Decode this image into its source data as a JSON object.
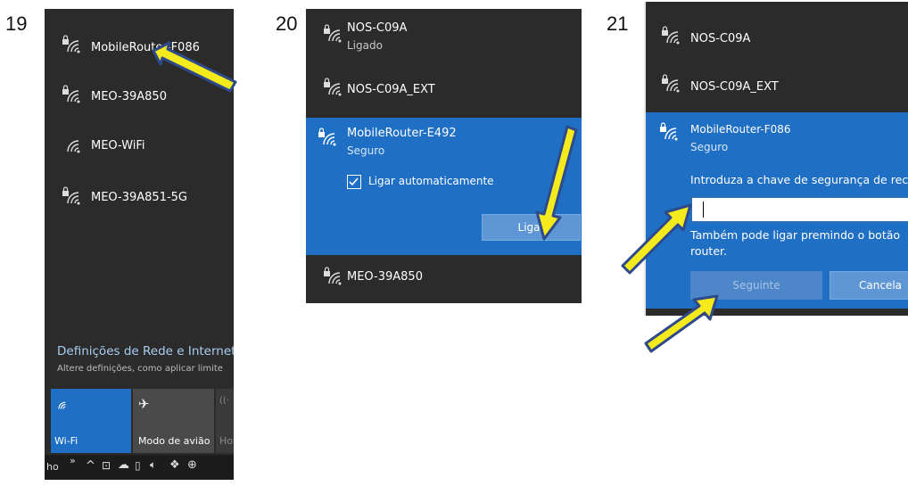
{
  "steps": [
    "19",
    "20",
    "21"
  ],
  "panel19": {
    "networks": [
      {
        "name": "MobileRouter-F086",
        "secured": true
      },
      {
        "name": "MEO-39A850",
        "secured": true
      },
      {
        "name": "MEO-WiFi",
        "secured": false
      },
      {
        "name": "MEO-39A851-5G",
        "secured": true
      }
    ],
    "settings_title": "Definições de Rede e Internet",
    "settings_sub": "Altere definições, como aplicar limite",
    "tiles": {
      "wifi": "Wi-Fi",
      "airplane": "Modo de avião",
      "hotspot": "Hot"
    },
    "taskbar_left": "ho",
    "taskbar_chevron": "»"
  },
  "panel20": {
    "networks_top": [
      {
        "name": "NOS-C09A",
        "status": "Ligado"
      },
      {
        "name": "NOS-C09A_EXT"
      }
    ],
    "selected": {
      "name": "MobileRouter-E492",
      "status": "Seguro",
      "auto_connect_label": "Ligar automaticamente",
      "auto_connect_checked": true,
      "connect_label": "Ligar"
    },
    "networks_bottom": [
      {
        "name": "MEO-39A850"
      }
    ]
  },
  "panel21": {
    "networks_top": [
      {
        "name": "NOS-C09A"
      },
      {
        "name": "NOS-C09A_EXT"
      }
    ],
    "selected": {
      "name": "MobileRouter-F086",
      "status": "Seguro",
      "prompt": "Introduza a chave de segurança de rec",
      "key_value": "",
      "hint": "Também pode ligar premindo o botão",
      "hint2": "router.",
      "next_label": "Seguinte",
      "cancel_label": "Cancela"
    }
  },
  "colors": {
    "panel_bg": "#2b2b2b",
    "selection_blue": "#1f6fc5",
    "arrow_fill": "#f5ea1c",
    "arrow_outline": "#2e4a8a"
  }
}
